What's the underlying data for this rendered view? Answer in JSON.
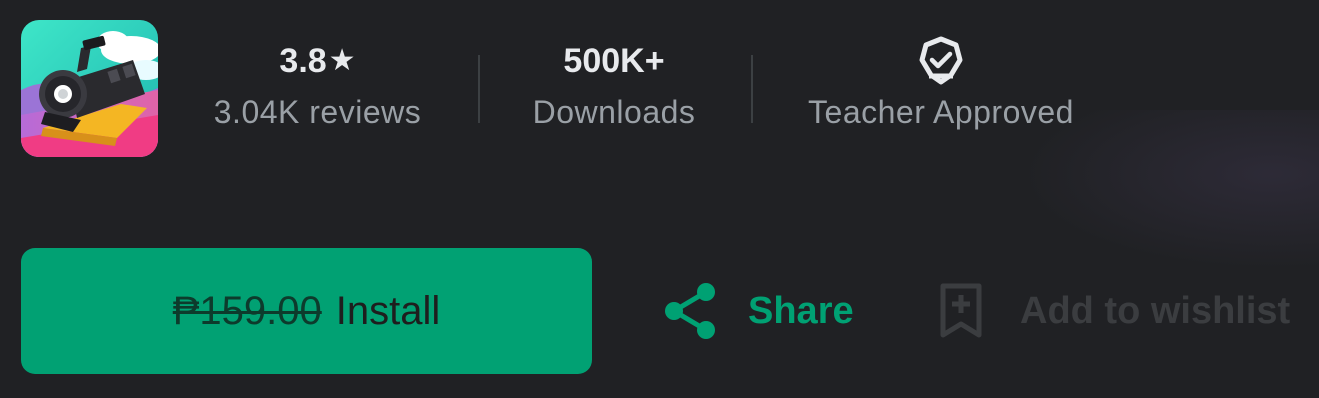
{
  "app": {
    "icon_name": "train-game-icon"
  },
  "stats": {
    "rating": {
      "value": "3.8",
      "star": "★",
      "label": "3.04K reviews"
    },
    "downloads": {
      "value": "500K+",
      "label": "Downloads"
    },
    "badge": {
      "icon": "teacher-approved-badge-icon",
      "label": "Teacher Approved"
    }
  },
  "actions": {
    "install": {
      "old_price": "₱159.00",
      "label": "Install"
    },
    "share": {
      "icon": "share-icon",
      "label": "Share"
    },
    "wishlist": {
      "icon": "bookmark-add-icon",
      "label": "Add to wishlist"
    }
  },
  "colors": {
    "background": "#202124",
    "accent": "#01a173",
    "text_primary": "#e8eaed",
    "text_secondary": "#9aa0a6",
    "disabled": "#3b3d40"
  }
}
